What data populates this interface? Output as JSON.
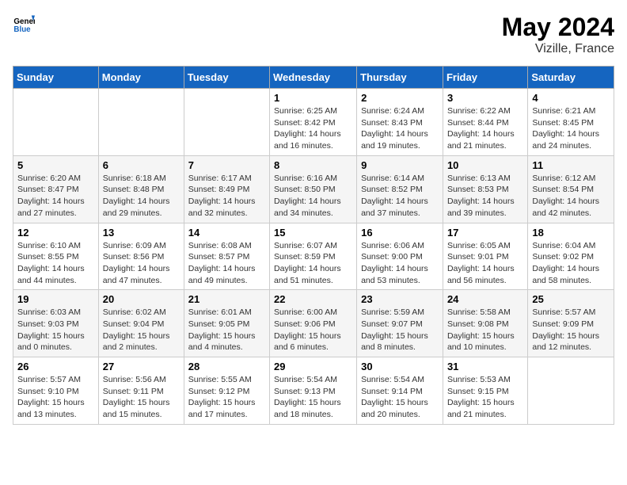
{
  "header": {
    "logo_general": "General",
    "logo_blue": "Blue",
    "month_year": "May 2024",
    "location": "Vizille, France"
  },
  "days_of_week": [
    "Sunday",
    "Monday",
    "Tuesday",
    "Wednesday",
    "Thursday",
    "Friday",
    "Saturday"
  ],
  "weeks": [
    [
      {
        "day": "",
        "info": ""
      },
      {
        "day": "",
        "info": ""
      },
      {
        "day": "",
        "info": ""
      },
      {
        "day": "1",
        "info": "Sunrise: 6:25 AM\nSunset: 8:42 PM\nDaylight: 14 hours\nand 16 minutes."
      },
      {
        "day": "2",
        "info": "Sunrise: 6:24 AM\nSunset: 8:43 PM\nDaylight: 14 hours\nand 19 minutes."
      },
      {
        "day": "3",
        "info": "Sunrise: 6:22 AM\nSunset: 8:44 PM\nDaylight: 14 hours\nand 21 minutes."
      },
      {
        "day": "4",
        "info": "Sunrise: 6:21 AM\nSunset: 8:45 PM\nDaylight: 14 hours\nand 24 minutes."
      }
    ],
    [
      {
        "day": "5",
        "info": "Sunrise: 6:20 AM\nSunset: 8:47 PM\nDaylight: 14 hours\nand 27 minutes."
      },
      {
        "day": "6",
        "info": "Sunrise: 6:18 AM\nSunset: 8:48 PM\nDaylight: 14 hours\nand 29 minutes."
      },
      {
        "day": "7",
        "info": "Sunrise: 6:17 AM\nSunset: 8:49 PM\nDaylight: 14 hours\nand 32 minutes."
      },
      {
        "day": "8",
        "info": "Sunrise: 6:16 AM\nSunset: 8:50 PM\nDaylight: 14 hours\nand 34 minutes."
      },
      {
        "day": "9",
        "info": "Sunrise: 6:14 AM\nSunset: 8:52 PM\nDaylight: 14 hours\nand 37 minutes."
      },
      {
        "day": "10",
        "info": "Sunrise: 6:13 AM\nSunset: 8:53 PM\nDaylight: 14 hours\nand 39 minutes."
      },
      {
        "day": "11",
        "info": "Sunrise: 6:12 AM\nSunset: 8:54 PM\nDaylight: 14 hours\nand 42 minutes."
      }
    ],
    [
      {
        "day": "12",
        "info": "Sunrise: 6:10 AM\nSunset: 8:55 PM\nDaylight: 14 hours\nand 44 minutes."
      },
      {
        "day": "13",
        "info": "Sunrise: 6:09 AM\nSunset: 8:56 PM\nDaylight: 14 hours\nand 47 minutes."
      },
      {
        "day": "14",
        "info": "Sunrise: 6:08 AM\nSunset: 8:57 PM\nDaylight: 14 hours\nand 49 minutes."
      },
      {
        "day": "15",
        "info": "Sunrise: 6:07 AM\nSunset: 8:59 PM\nDaylight: 14 hours\nand 51 minutes."
      },
      {
        "day": "16",
        "info": "Sunrise: 6:06 AM\nSunset: 9:00 PM\nDaylight: 14 hours\nand 53 minutes."
      },
      {
        "day": "17",
        "info": "Sunrise: 6:05 AM\nSunset: 9:01 PM\nDaylight: 14 hours\nand 56 minutes."
      },
      {
        "day": "18",
        "info": "Sunrise: 6:04 AM\nSunset: 9:02 PM\nDaylight: 14 hours\nand 58 minutes."
      }
    ],
    [
      {
        "day": "19",
        "info": "Sunrise: 6:03 AM\nSunset: 9:03 PM\nDaylight: 15 hours\nand 0 minutes."
      },
      {
        "day": "20",
        "info": "Sunrise: 6:02 AM\nSunset: 9:04 PM\nDaylight: 15 hours\nand 2 minutes."
      },
      {
        "day": "21",
        "info": "Sunrise: 6:01 AM\nSunset: 9:05 PM\nDaylight: 15 hours\nand 4 minutes."
      },
      {
        "day": "22",
        "info": "Sunrise: 6:00 AM\nSunset: 9:06 PM\nDaylight: 15 hours\nand 6 minutes."
      },
      {
        "day": "23",
        "info": "Sunrise: 5:59 AM\nSunset: 9:07 PM\nDaylight: 15 hours\nand 8 minutes."
      },
      {
        "day": "24",
        "info": "Sunrise: 5:58 AM\nSunset: 9:08 PM\nDaylight: 15 hours\nand 10 minutes."
      },
      {
        "day": "25",
        "info": "Sunrise: 5:57 AM\nSunset: 9:09 PM\nDaylight: 15 hours\nand 12 minutes."
      }
    ],
    [
      {
        "day": "26",
        "info": "Sunrise: 5:57 AM\nSunset: 9:10 PM\nDaylight: 15 hours\nand 13 minutes."
      },
      {
        "day": "27",
        "info": "Sunrise: 5:56 AM\nSunset: 9:11 PM\nDaylight: 15 hours\nand 15 minutes."
      },
      {
        "day": "28",
        "info": "Sunrise: 5:55 AM\nSunset: 9:12 PM\nDaylight: 15 hours\nand 17 minutes."
      },
      {
        "day": "29",
        "info": "Sunrise: 5:54 AM\nSunset: 9:13 PM\nDaylight: 15 hours\nand 18 minutes."
      },
      {
        "day": "30",
        "info": "Sunrise: 5:54 AM\nSunset: 9:14 PM\nDaylight: 15 hours\nand 20 minutes."
      },
      {
        "day": "31",
        "info": "Sunrise: 5:53 AM\nSunset: 9:15 PM\nDaylight: 15 hours\nand 21 minutes."
      },
      {
        "day": "",
        "info": ""
      }
    ]
  ]
}
